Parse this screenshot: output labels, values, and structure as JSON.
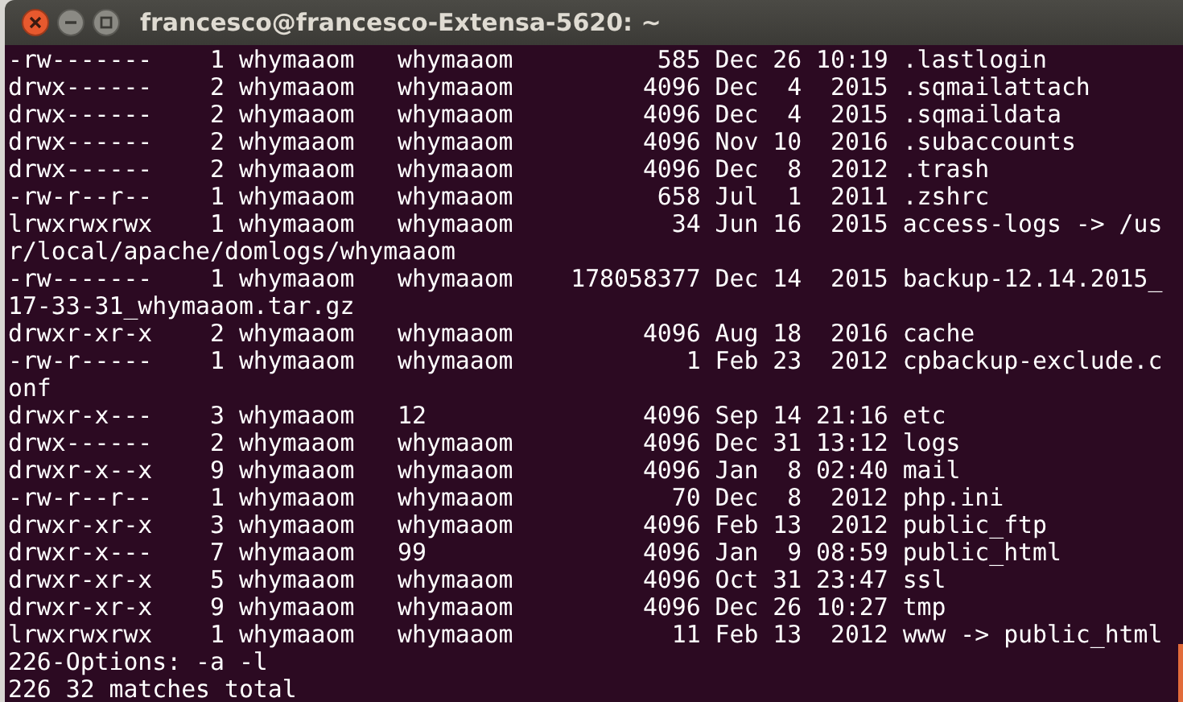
{
  "window": {
    "title": "francesco@francesco-Extensa-5620: ~"
  },
  "terminal": {
    "lines": [
      "-rw-------    1 whymaaom   whymaaom          585 Dec 26 10:19 .lastlogin",
      "drwx------    2 whymaaom   whymaaom         4096 Dec  4  2015 .sqmailattach",
      "drwx------    2 whymaaom   whymaaom         4096 Dec  4  2015 .sqmaildata",
      "drwx------    2 whymaaom   whymaaom         4096 Nov 10  2016 .subaccounts",
      "drwx------    2 whymaaom   whymaaom         4096 Dec  8  2012 .trash",
      "-rw-r--r--    1 whymaaom   whymaaom          658 Jul  1  2011 .zshrc",
      "lrwxrwxrwx    1 whymaaom   whymaaom           34 Jun 16  2015 access-logs -> /us",
      "r/local/apache/domlogs/whymaaom",
      "-rw-------    1 whymaaom   whymaaom    178058377 Dec 14  2015 backup-12.14.2015_",
      "17-33-31_whymaaom.tar.gz",
      "drwxr-xr-x    2 whymaaom   whymaaom         4096 Aug 18  2016 cache",
      "-rw-r-----    1 whymaaom   whymaaom            1 Feb 23  2012 cpbackup-exclude.c",
      "onf",
      "drwxr-x---    3 whymaaom   12               4096 Sep 14 21:16 etc",
      "drwx------    2 whymaaom   whymaaom         4096 Dec 31 13:12 logs",
      "drwxr-x--x    9 whymaaom   whymaaom         4096 Jan  8 02:40 mail",
      "-rw-r--r--    1 whymaaom   whymaaom           70 Dec  8  2012 php.ini",
      "drwxr-xr-x    3 whymaaom   whymaaom         4096 Feb 13  2012 public_ftp",
      "drwxr-x---    7 whymaaom   99               4096 Jan  9 08:59 public_html",
      "drwxr-xr-x    5 whymaaom   whymaaom         4096 Oct 31 23:47 ssl",
      "drwxr-xr-x    9 whymaaom   whymaaom         4096 Dec 26 10:27 tmp",
      "lrwxrwxrwx    1 whymaaom   whymaaom           11 Feb 13  2012 www -> public_html",
      "226-Options: -a -l",
      "226 32 matches total"
    ]
  }
}
